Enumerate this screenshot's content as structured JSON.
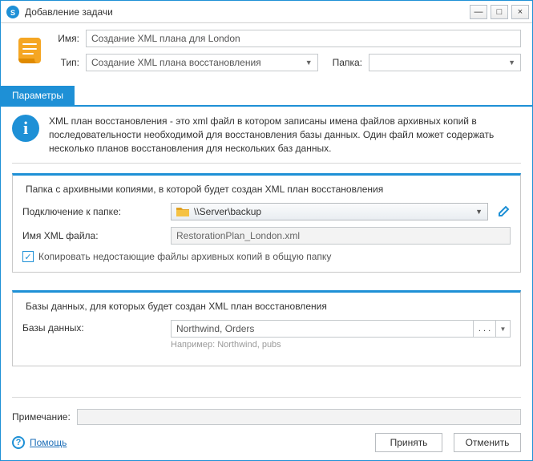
{
  "titlebar": {
    "title": "Добавление задачи"
  },
  "header": {
    "name_label": "Имя:",
    "name_value": "Создание XML плана для London",
    "type_label": "Тип:",
    "type_value": "Создание XML плана восстановления",
    "folder_label": "Папка:",
    "folder_value": ""
  },
  "tab": {
    "params": "Параметры"
  },
  "info": "XML план восстановления - это xml файл в котором записаны имена файлов архивных копий в последовательности необходимой для восстановления базы данных. Один файл может содержать несколько планов восстановления для нескольких баз данных.",
  "group1": {
    "title": "Папка с архивными копиями, в которой будет создан XML план восстановления",
    "conn_label": "Подключение к папке:",
    "conn_value": "\\\\Server\\backup",
    "file_label": "Имя XML файла:",
    "file_value": "RestorationPlan_London.xml",
    "copy_label": "Копировать недостающие файлы архивных копий в общую папку"
  },
  "group2": {
    "title": "Базы данных, для которых будет создан XML план восстановления",
    "db_label": "Базы данных:",
    "db_value": "Northwind, Orders",
    "db_more": ". . .",
    "hint": "Например: Northwind, pubs"
  },
  "footer": {
    "note_label": "Примечание:",
    "help": "Помощь",
    "ok": "Принять",
    "cancel": "Отменить"
  }
}
